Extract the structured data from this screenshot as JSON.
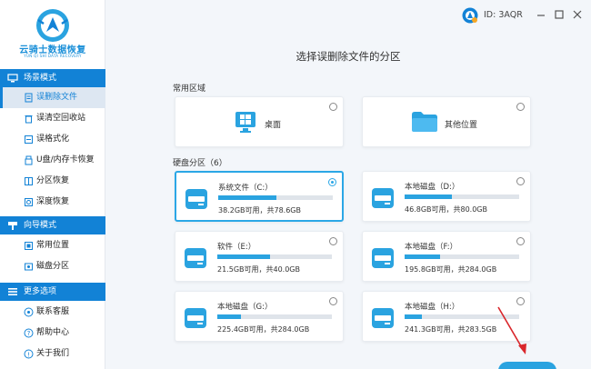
{
  "app": {
    "logo_title": "云骑士数据恢复",
    "logo_subtitle": "YUN QI SHI DATA RECOVERY",
    "user_id": "ID: 3AQR"
  },
  "sidebar": {
    "section_scene": "场景模式",
    "scene_items": [
      {
        "label": "误删除文件",
        "active": true
      },
      {
        "label": "误清空回收站"
      },
      {
        "label": "误格式化"
      },
      {
        "label": "U盘/内存卡恢复"
      },
      {
        "label": "分区恢复"
      },
      {
        "label": "深度恢复"
      }
    ],
    "section_wizard": "向导模式",
    "wizard_items": [
      {
        "label": "常用位置"
      },
      {
        "label": "磁盘分区"
      }
    ],
    "section_more": "更多选项",
    "more_items": [
      {
        "label": "联系客服"
      },
      {
        "label": "帮助中心"
      },
      {
        "label": "关于我们"
      }
    ]
  },
  "main": {
    "title": "选择误删除文件的分区",
    "common_area_label": "常用区域",
    "common_locations": [
      {
        "label": "桌面"
      },
      {
        "label": "其他位置"
      }
    ],
    "disk_section_label": "硬盘分区（6）",
    "drives": [
      {
        "name": "系统文件（C:）",
        "size": "38.2GB可用，共78.6GB",
        "used": 0.51,
        "selected": true
      },
      {
        "name": "本地磁盘（D:）",
        "size": "46.8GB可用，共80.0GB",
        "used": 0.41
      },
      {
        "name": "软件（E:）",
        "size": "21.5GB可用，共40.0GB",
        "used": 0.46
      },
      {
        "name": "本地磁盘（F:）",
        "size": "195.8GB可用，共284.0GB",
        "used": 0.31
      },
      {
        "name": "本地磁盘（G:）",
        "size": "225.4GB可用，共284.0GB",
        "used": 0.21
      },
      {
        "name": "本地磁盘（H:）",
        "size": "241.3GB可用，共283.5GB",
        "used": 0.15
      }
    ]
  },
  "colors": {
    "accent": "#1282d6",
    "bar_fill": "#2aa3e0",
    "annotation_arrow": "#d9262b"
  },
  "icons": {
    "desktop": "windows-desktop-icon",
    "other": "folder-icon",
    "drive": "hard-drive-icon"
  }
}
